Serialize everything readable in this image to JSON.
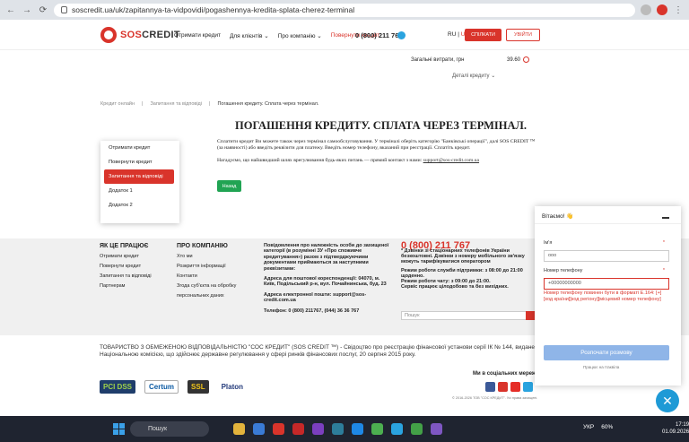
{
  "browser": {
    "url": "soscredit.ua/uk/zapitannya-ta-vidpovidi/pogashennya-kredita-splata-cherez-terminal"
  },
  "header": {
    "logo": {
      "brand_sos": "SOS",
      "brand_credit": "CREDIT"
    },
    "menu": [
      "Отримати кредит",
      "Для клієнтів ⌄",
      "Про компанію ⌄",
      "Повернути кредит"
    ],
    "phone": "0 (800) 211 767",
    "lang_ru": "RU",
    "lang_ua": "UA",
    "signup": "СПІЛКАТИ",
    "login": "УВІЙТИ"
  },
  "dropdown": {
    "row_label": "Загальні витрати, грн",
    "row_value": "39.60",
    "details": "Деталі кредиту ⌄"
  },
  "breadcrumbs": [
    "Кредит онлайн",
    "Запитання та відповіді",
    "Погашення кредиту. Сплата через термінал."
  ],
  "page": {
    "title": "ПОГАШЕННЯ КРЕДИТУ. СПЛАТА ЧЕРЕЗ ТЕРМІНАЛ.",
    "para1": "Сплатити кредит Ви можете також через термінал самообслуговування. У терміналі оберіть категорію \"Банківські операції\", далі SOS CREDIT ™ (за наявності) або введіть реквізити для платежу. Введіть номер телефону, вказаний при реєстрації. Сплатіть кредит.",
    "para2_prefix": "Нагадуємо, що найшвидший шлях врегулювання будь-яких питань — прямий контакт з нами:",
    "para2_email": "support@sos-credit.com.ua",
    "back": "Назад"
  },
  "sidebar": {
    "items": [
      "Отримати кредит",
      "Повернути кредит",
      "Запитання та відповіді",
      "Додаток 1",
      "Додаток 2"
    ]
  },
  "footer": {
    "col1": {
      "title": "ЯК ЦЕ ПРАЦЮЄ",
      "items": [
        "Отримати кредит",
        "Повернути кредит",
        "Запитання та відповіді",
        "Партнерам"
      ]
    },
    "col2": {
      "title": "ПРО КОМПАНІЮ",
      "items": [
        "Хто ми",
        "Розкриття інформації",
        "Контакти",
        "Згода суб'єкта на обробку",
        "персональних даних"
      ]
    },
    "col3": {
      "notice": "Повідомлення про належність особи до захищеної категорії (в розумінні ЗУ «Про споживче кредитування») разом з підтверджуючими документами приймаються за наступними реквізитами:",
      "address": "Адреса для поштової кореспонденції: 04070, м. Київ, Подільський р-н, вул. Почайнинська, буд. 23",
      "email": "Адреса електронної пошти: support@sos-credit.com.ua",
      "phones": "Телефон: 0 (800) 211767, (044) 36 36 767"
    },
    "col4": {
      "phone": "0 (800) 211 767",
      "note": "* Дзвінки зі стаціонарних телефонів України безкоштовні. Дзвінки з номеру мобільного зв'язку можуть тарифікуватися оператором",
      "hours1": "Режим роботи служби підтримки: з 08:00 до 21:00 щоденно.",
      "hours2": "Режим роботи чату: з 09:00 до 21:00.",
      "hours3": "Сервіс працює цілодобово та без вихідних."
    },
    "search_placeholder": "Пошук"
  },
  "legal": "ТОВАРИСТВО З ОБМЕЖЕНОЮ ВІДПОВІДАЛЬНІСТЮ \"СОС КРЕДИТ\" (SOS CREDIT ™) - Свідоцтво про реєстрацію фінансової установи серії ІК № 144, видане Національною комісією, що здійснює державне регулювання у сфері ринків фінансових послуг, 20 серпня 2015 року.",
  "social": {
    "title": "Ми в соціальних мережах",
    "copyright": "© 2016-2026 ТОВ \"СОС КРЕДИТ\". Усі права захищені."
  },
  "badges": [
    "PCI DSS",
    "Certum",
    "SSL",
    "Platon"
  ],
  "chat": {
    "greeting": "Вітаємо! 👋",
    "name_label": "Ім'я",
    "name_value": "ооо",
    "phone_label": "Номер телефону",
    "phone_value": "+00000000000",
    "error": "Номер телефону повинен бути в форматі E.164: [+][код країни][код регіону][місцевий номер телефону]",
    "submit": "Розпочати розмову",
    "powered": "Працює на Ітаквіла"
  },
  "taskbar": {
    "search": "Пошук",
    "lang": "УКР",
    "battery": "60%",
    "time": "17:19",
    "date": "01.09.2026"
  }
}
